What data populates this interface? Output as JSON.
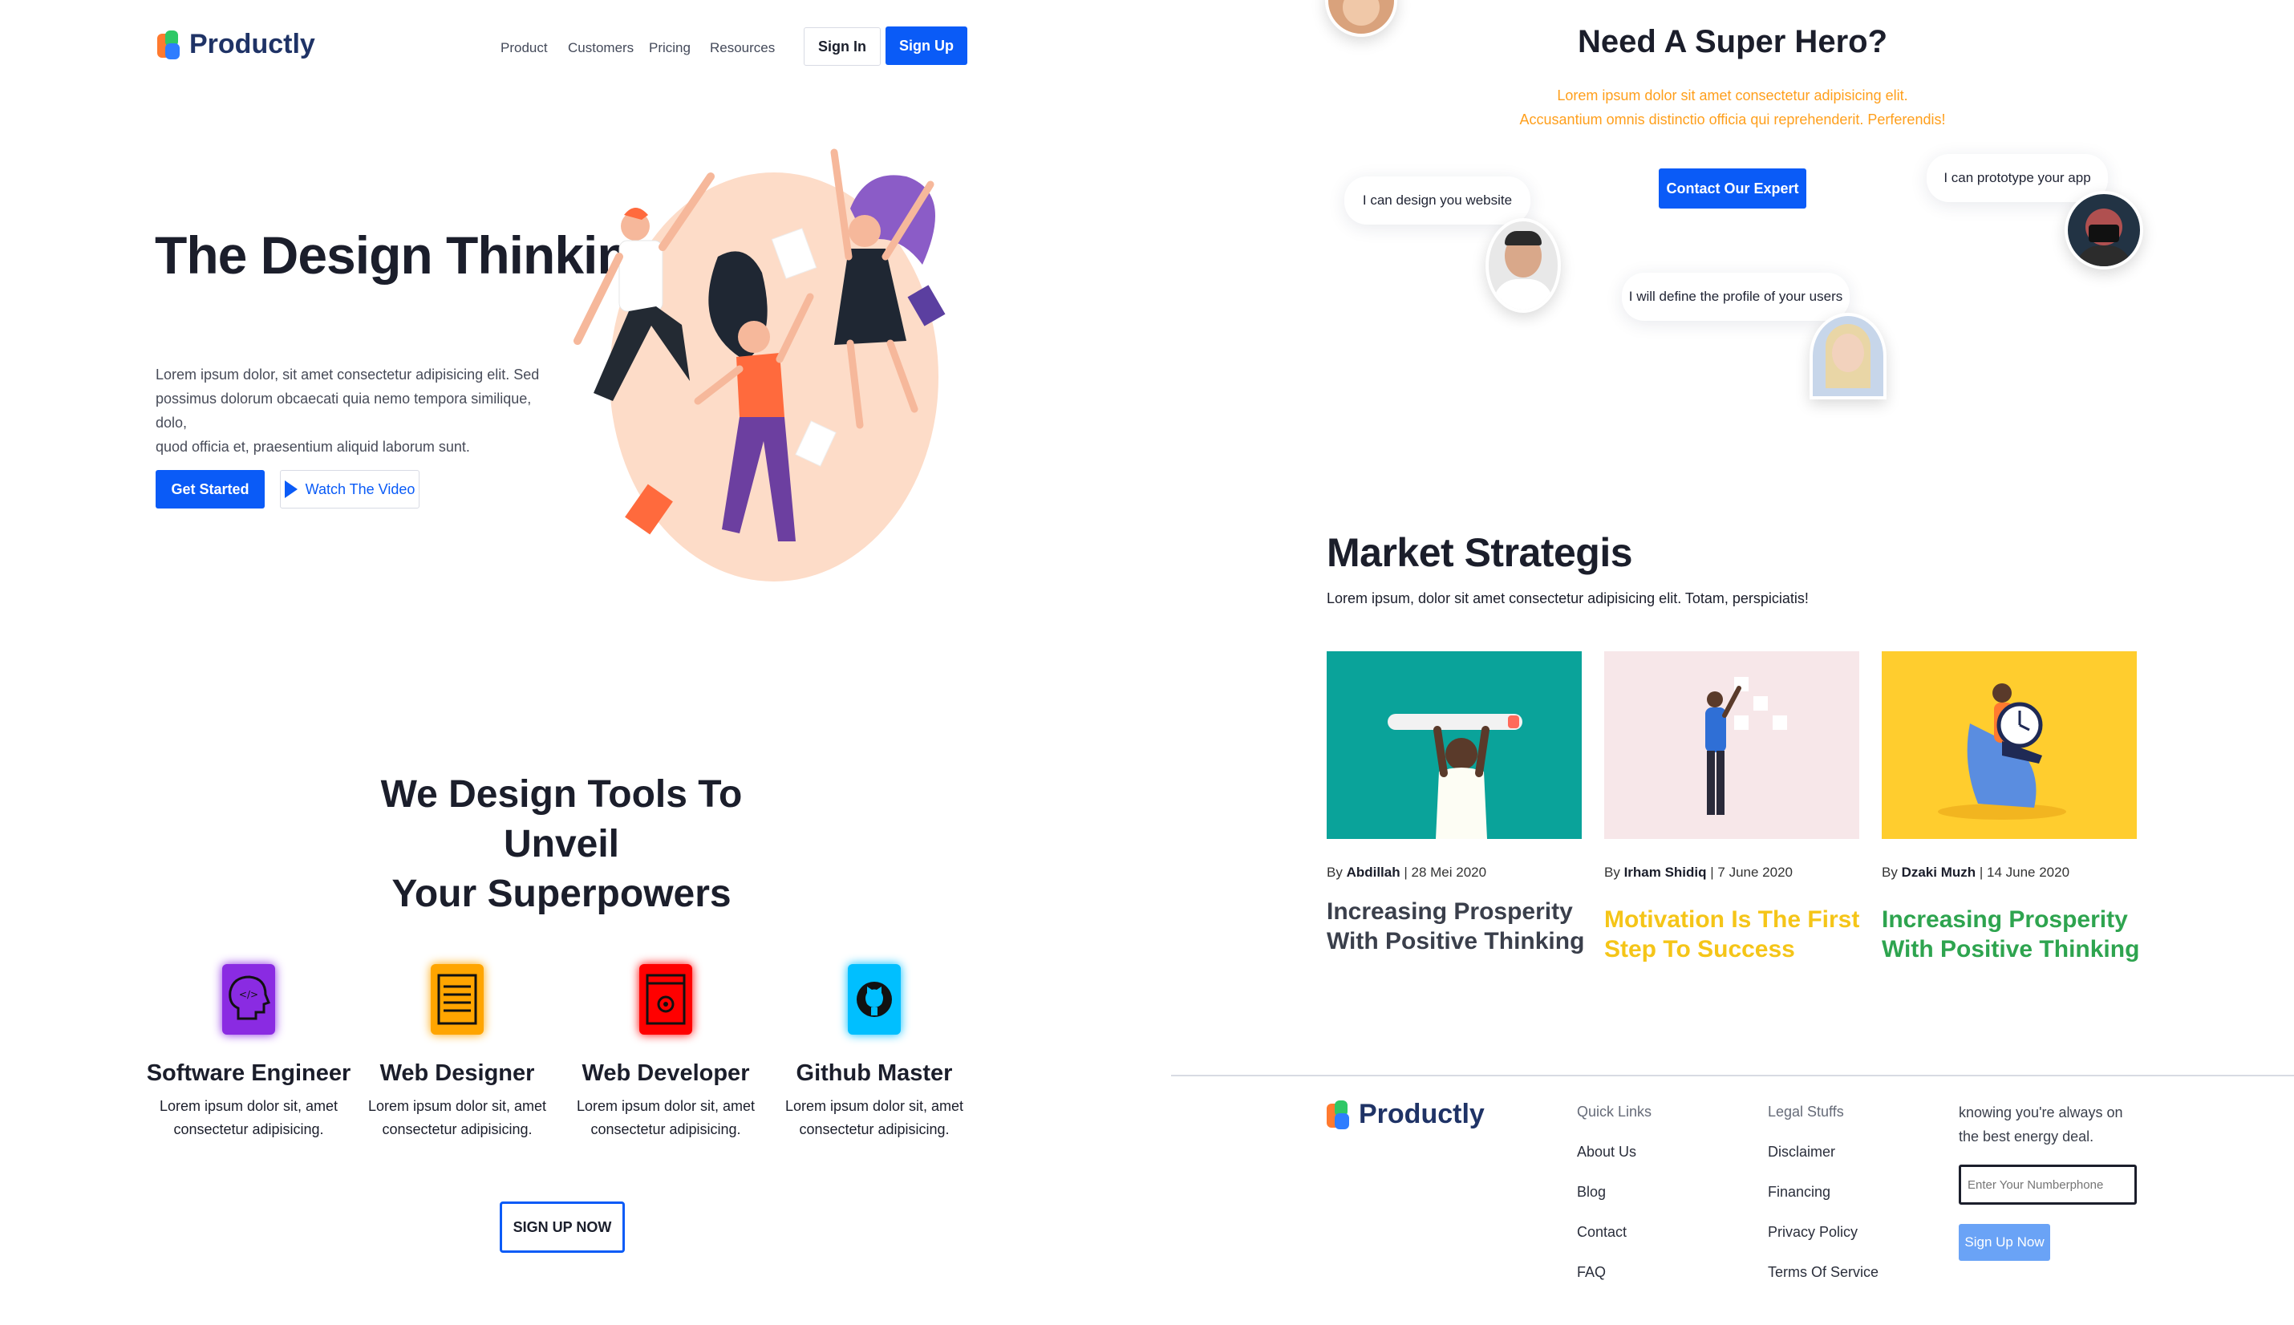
{
  "header": {
    "logo_text": "Productly",
    "nav": [
      "Product",
      "Customers",
      "Pricing",
      "Resources"
    ],
    "sign_in": "Sign In",
    "sign_up": "Sign Up"
  },
  "hero": {
    "title": "The Design Thinking",
    "description_lines": [
      "Lorem ipsum dolor, sit amet consectetur adipisicing elit. Sed",
      "possimus dolorum obcaecati quia nemo tempora similique, dolo,",
      "quod officia et, praesentium aliquid laborum sunt."
    ],
    "get_started": "Get Started",
    "watch_video": "Watch The Video"
  },
  "tools": {
    "title_lines": [
      "We Design Tools To Unveil",
      "Your Superpowers"
    ],
    "features": [
      {
        "title": "Software Engineer",
        "line1": "Lorem ipsum dolor sit, amet",
        "line2": "consectetur adipisicing.",
        "color": "#8a2be2",
        "icon": "head-code-icon"
      },
      {
        "title": "Web Designer",
        "line1": "Lorem ipsum dolor sit, amet",
        "line2": "consectetur adipisicing.",
        "color": "#ffa500",
        "icon": "document-icon"
      },
      {
        "title": "Web Developer",
        "line1": "Lorem ipsum dolor sit, amet",
        "line2": "consectetur adipisicing.",
        "color": "#ff0000",
        "icon": "gear-browser-icon"
      },
      {
        "title": "Github Master",
        "line1": "Lorem ipsum dolor sit, amet",
        "line2": "consectetur adipisicing.",
        "color": "#00bfff",
        "icon": "github-icon"
      }
    ],
    "cta": "SIGN UP NOW"
  },
  "hero2": {
    "title": "Need A Super Hero?",
    "subtitle_line1": "Lorem ipsum dolor sit amet consectetur adipisicing elit.",
    "subtitle_line2": "Accusantium omnis distinctio officia qui reprehenderit. Perferendis!",
    "cta": "Contact Our Expert",
    "bubbles": [
      "I can design you website",
      "I will define the profile of your users",
      "I can prototype your app"
    ],
    "accent": "#ff9f1c"
  },
  "market": {
    "title": "Market Strategis",
    "subtitle": "Lorem ipsum, dolor sit amet consectetur adipisicing elit. Totam, perspiciatis!",
    "cards": [
      {
        "by": "By ",
        "author": "Abdillah",
        "date": " | 28 Mei 2020",
        "title_line1": "Increasing Prosperity",
        "title_line2": "With Positive Thinking",
        "color": "#3a3f4b"
      },
      {
        "by": "By ",
        "author": "Irham Shidiq",
        "date": " | 7 June 2020",
        "title_line1": "Motivation Is The First",
        "title_line2": "Step To Success",
        "color": "#f5c518"
      },
      {
        "by": "By ",
        "author": "Dzaki Muzh",
        "date": " | 14 June 2020",
        "title_line1": "Increasing Prosperity",
        "title_line2": "With Positive Thinking",
        "color": "#2ea44f"
      }
    ]
  },
  "footer": {
    "logo_text": "Productly",
    "quick_links_title": "Quick Links",
    "quick_links": [
      "About Us",
      "Blog",
      "Contact",
      "FAQ"
    ],
    "legal_title": "Legal Stuffs",
    "legal_links": [
      "Disclaimer",
      "Financing",
      "Privacy Policy",
      "Terms Of Service"
    ],
    "newsletter_line1": "knowing you're always on",
    "newsletter_line2": "the best energy deal.",
    "phone_placeholder": "Enter Your Numberphone",
    "signup": "Sign Up Now"
  }
}
